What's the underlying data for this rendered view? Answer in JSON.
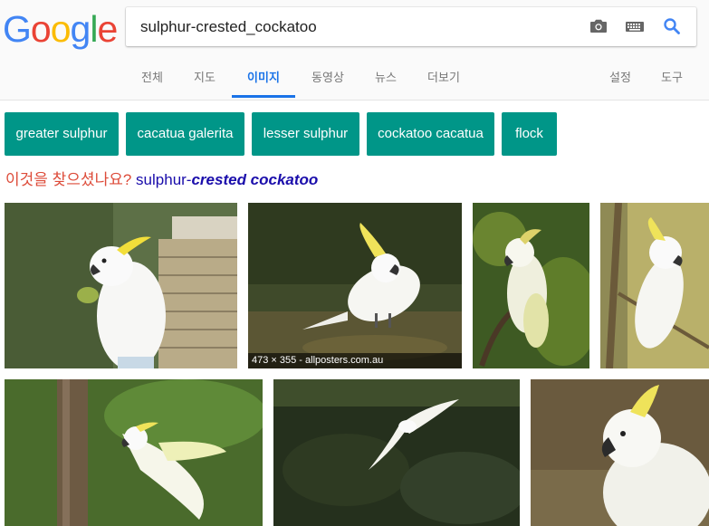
{
  "logo": {
    "letters": [
      "G",
      "o",
      "o",
      "g",
      "l",
      "e"
    ],
    "colors": [
      "#4285f4",
      "#ea4335",
      "#fbbc05",
      "#4285f4",
      "#34a853",
      "#ea4335"
    ]
  },
  "search": {
    "query": "sulphur-crested_cockatoo"
  },
  "icons": {
    "camera": "camera-icon",
    "keyboard": "keyboard-icon",
    "search": "search-icon"
  },
  "tabs": {
    "all": "전체",
    "maps": "지도",
    "images": "이미지",
    "videos": "동영상",
    "news": "뉴스",
    "more": "더보기",
    "settings": "설정",
    "tools": "도구"
  },
  "chips": [
    "greater sulphur",
    "cacatua galerita",
    "lesser sulphur",
    "cockatoo cacatua",
    "flock"
  ],
  "did_you_mean": {
    "label": "이것을 찾으셨나요?",
    "plain": "sulphur-",
    "bold": "crested cockatoo"
  },
  "results": [
    {
      "caption": ""
    },
    {
      "caption": "473 × 355 - allposters.com.au"
    },
    {
      "caption": ""
    },
    {
      "caption": ""
    },
    {
      "caption": ""
    },
    {
      "caption": ""
    },
    {
      "caption": ""
    }
  ],
  "colors": {
    "accent": "#1a73e8",
    "chip": "#009688",
    "dym_label": "#dd4b39",
    "link": "#1a0dab"
  }
}
